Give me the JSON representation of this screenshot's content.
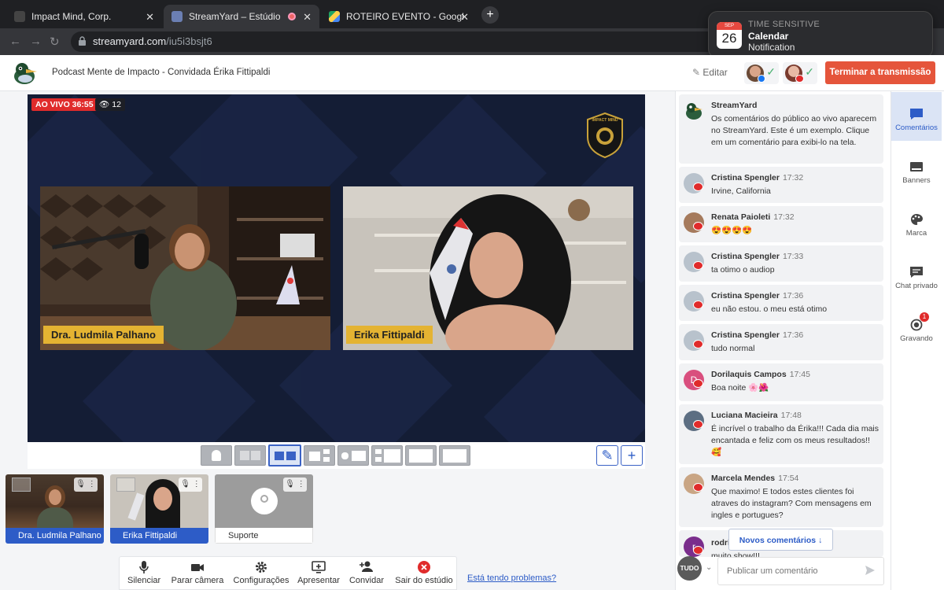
{
  "browser": {
    "tabs": [
      {
        "title": "Impact Mind, Corp.",
        "active": false
      },
      {
        "title": "StreamYard – Estúdio",
        "active": true
      },
      {
        "title": "ROTEIRO EVENTO - Google D",
        "active": false
      }
    ],
    "new_tab": "+",
    "url_host": "streamyard.com",
    "url_path": "/iu5i3bsjt6"
  },
  "notification": {
    "month": "SEP",
    "day": "26",
    "label": "TIME SENSITIVE",
    "app": "Calendar",
    "text": "Notification"
  },
  "header": {
    "title": "Podcast Mente de Impacto - Convidada Érika Fittipaldi",
    "edit": "Editar",
    "end_broadcast": "Terminar a transmissão"
  },
  "stage": {
    "live_badge": "AO VIVO 36:55",
    "viewers": "12",
    "brand": "IMPACT MIND",
    "participants": [
      "Dra. Ludmila Palhano",
      "Erika Fittipaldi"
    ]
  },
  "guests": [
    {
      "name": "Dra. Ludmila Palhano",
      "on_stage": true
    },
    {
      "name": "Erika Fittipaldi",
      "on_stage": true
    },
    {
      "name": "Suporte",
      "on_stage": false
    }
  ],
  "controls": {
    "mute": "Silenciar",
    "stop_camera": "Parar câmera",
    "settings": "Configurações",
    "present": "Apresentar",
    "invite": "Convidar",
    "leave": "Sair do estúdio",
    "problems": "Está tendo problemas?"
  },
  "comments": [
    {
      "name": "StreamYard",
      "time": "",
      "text": "Os comentários do público ao vivo aparecem no StreamYard. Este é um exemplo. Clique em um comentário para exibi-lo na tela."
    },
    {
      "name": "Cristina Spengler",
      "time": "17:32",
      "text": "Irvine, California"
    },
    {
      "name": "Renata Paioleti",
      "time": "17:32",
      "text": "😍😍😍😍"
    },
    {
      "name": "Cristina Spengler",
      "time": "17:33",
      "text": "ta otimo o audiop"
    },
    {
      "name": "Cristina Spengler",
      "time": "17:36",
      "text": "eu não estou. o meu está otimo"
    },
    {
      "name": "Cristina Spengler",
      "time": "17:36",
      "text": "tudo normal"
    },
    {
      "name": "Dorilaquis Campos",
      "time": "17:45",
      "text": "Boa noite 🌸🌺"
    },
    {
      "name": "Luciana Macieira",
      "time": "17:48",
      "text": "É incrível o trabalho da Érika!!! Cada dia mais encantada e feliz com os meus resultados!! 🥰"
    },
    {
      "name": "Marcela Mendes",
      "time": "17:54",
      "text": "Que maximo! E todos estes clientes foi atraves do instagram? Com mensagens em ingles e portugues?"
    },
    {
      "name": "rodri",
      "time": "",
      "text": "muito show!!!"
    }
  ],
  "comment_avatar_letters": {
    "dorilaquis": "D",
    "rodri": "r"
  },
  "new_comments": "Novos comentários",
  "filter": "TUDO",
  "comment_input_placeholder": "Publicar um comentário",
  "rail": [
    {
      "label": "Comentários",
      "selected": true
    },
    {
      "label": "Banners",
      "selected": false
    },
    {
      "label": "Marca",
      "selected": false
    },
    {
      "label": "Chat privado",
      "selected": false
    },
    {
      "label": "Gravando",
      "selected": false,
      "badge": "1"
    }
  ],
  "colors": {
    "accent": "#2d5cc7",
    "live": "#e02b2b",
    "end_button": "#e5553b",
    "nameplate": "#e4b332",
    "stage_bg": "#141d35"
  }
}
